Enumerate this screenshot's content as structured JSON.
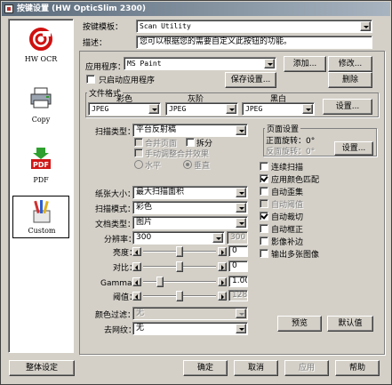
{
  "window": {
    "title": "按键设置 (HW OpticSlim 2300)"
  },
  "sidebar": {
    "items": [
      {
        "label": "HW OCR",
        "icon": "hw-ocr-icon"
      },
      {
        "label": "Copy",
        "icon": "printer-icon"
      },
      {
        "label": "PDF",
        "icon": "pdf-icon"
      },
      {
        "label": "Custom",
        "icon": "custom-brushes-icon"
      }
    ]
  },
  "template": {
    "label": "按键模板：",
    "value": "Scan Utility"
  },
  "description": {
    "label": "描述：",
    "value": "您可以根据您的需要自定义此按钮的功能。"
  },
  "application": {
    "label": "应用程序：",
    "value": "MS Paint",
    "add_button": "添加...",
    "modify_button": "修改...",
    "launch_only_label": "只启动应用程序",
    "save_settings_button": "保存设置...",
    "delete_button": "删除"
  },
  "file_format": {
    "group_label": "文件格式",
    "color_label": "彩色",
    "gray_label": "灰阶",
    "bw_label": "黑白",
    "color_value": "JPEG",
    "gray_value": "JPEG",
    "bw_value": "JPEG",
    "settings_button": "设置..."
  },
  "scan_type": {
    "label": "扫描类型：",
    "value": "平台反射稿",
    "merge_pages_label": "合并页面",
    "split_label": "拆分",
    "manual_merge_label": "手动调整合并效果",
    "horizontal_label": "水平",
    "vertical_label": "垂直"
  },
  "page_settings": {
    "group_label": "页面设置",
    "front_rotation": "正面旋转：0°",
    "back_rotation": "反面旋转：0°",
    "settings_button": "设置..."
  },
  "options": [
    {
      "label": "连续扫描",
      "checked": false,
      "enabled": true
    },
    {
      "label": "应用颜色匹配",
      "checked": true,
      "enabled": true
    },
    {
      "label": "自动歪集",
      "checked": false,
      "enabled": true
    },
    {
      "label": "自动阈值",
      "checked": false,
      "enabled": false
    },
    {
      "label": "自动裁切",
      "checked": true,
      "enabled": true
    },
    {
      "label": "自动框正",
      "checked": false,
      "enabled": true
    },
    {
      "label": "影像补边",
      "checked": false,
      "enabled": true
    },
    {
      "label": "输出多张图像",
      "checked": false,
      "enabled": true
    }
  ],
  "paper_size": {
    "label": "纸张大小：",
    "value": "最大扫描面积"
  },
  "scan_mode": {
    "label": "扫描模式：",
    "value": "彩色"
  },
  "doc_type": {
    "label": "文档类型：",
    "value": "图片"
  },
  "resolution": {
    "label": "分辨率：",
    "value": "300",
    "alt_value": "300"
  },
  "brightness": {
    "label": "亮度：",
    "value": "0",
    "level": 0.5
  },
  "contrast": {
    "label": "对比：",
    "value": "0",
    "level": 0.5
  },
  "gamma": {
    "label": "Gamma：",
    "value": "1.00",
    "level": 0.2
  },
  "threshold": {
    "label": "阈值：",
    "value": "128",
    "level": 0.5
  },
  "color_filter": {
    "label": "颜色过滤：",
    "value": "无"
  },
  "descreen": {
    "label": "去网纹：",
    "value": "无"
  },
  "preview_button": "预览",
  "default_button": "默认值",
  "footer": {
    "global_settings": "整体设定",
    "ok": "确定",
    "cancel": "取消",
    "apply": "应用",
    "help": "帮助"
  }
}
